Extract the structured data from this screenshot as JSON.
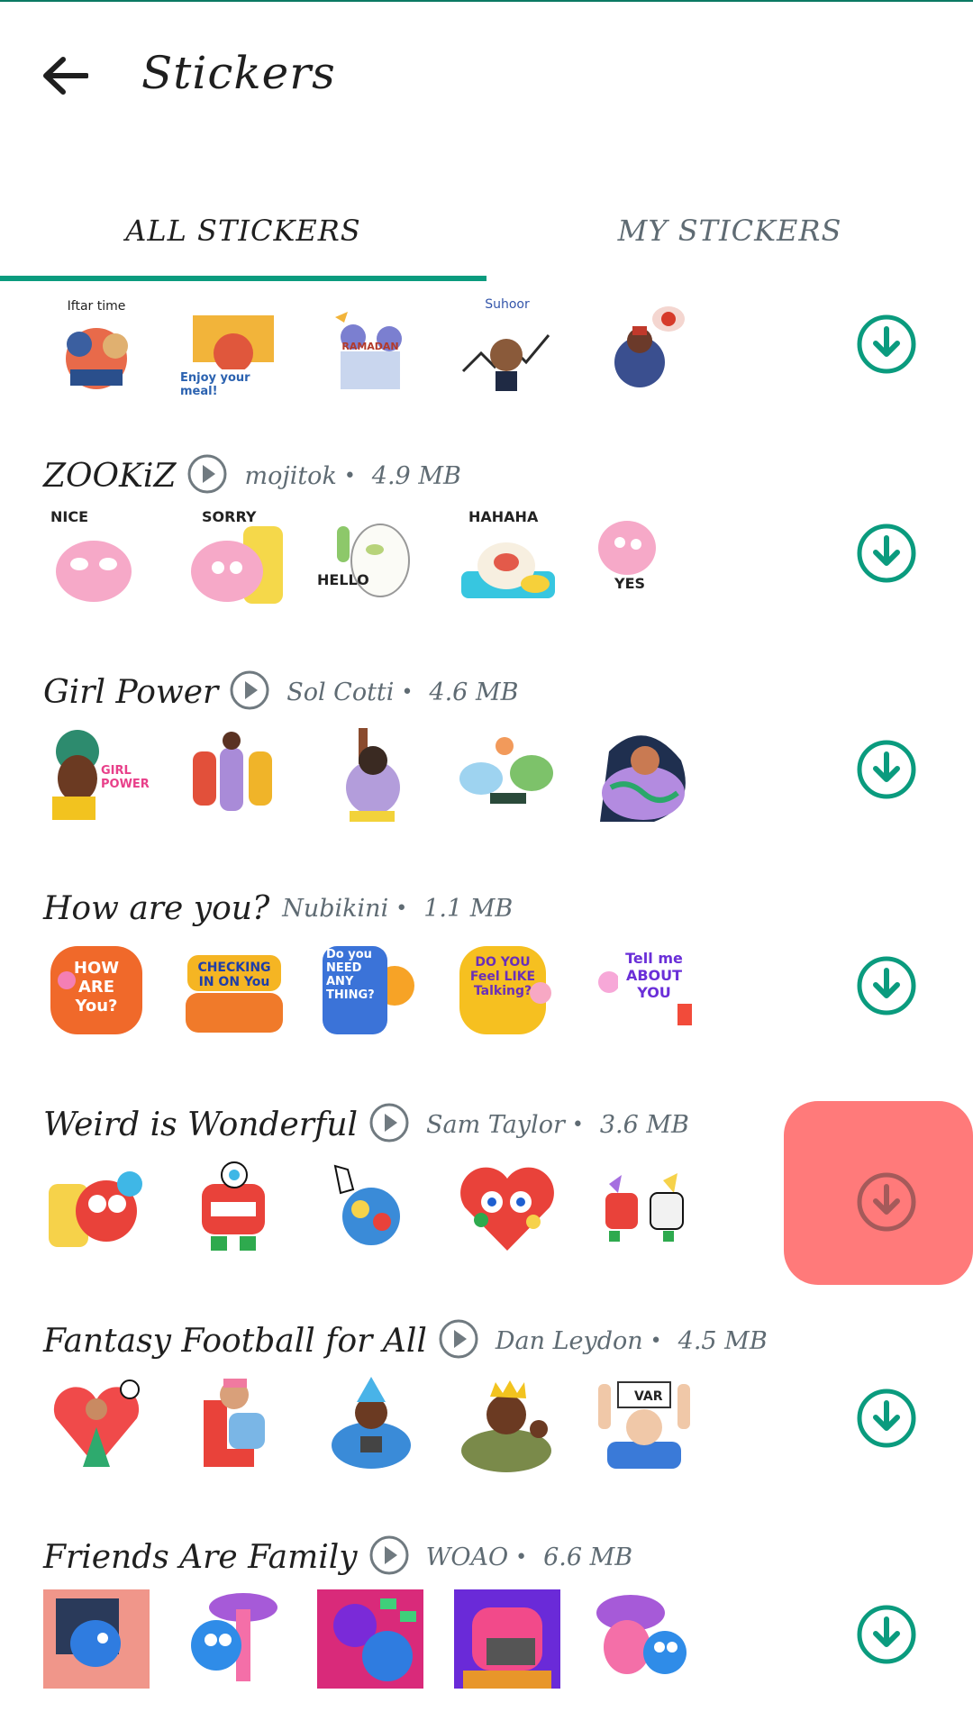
{
  "header": {
    "title": "Stickers"
  },
  "tabs": [
    {
      "label": "ALL STICKERS",
      "active": true
    },
    {
      "label": "MY STICKERS",
      "active": false
    }
  ],
  "colors": {
    "accent": "#0a9b7e",
    "highlight": "#ff7a7a"
  },
  "partial_pack": {
    "sticker_texts": [
      "Iftar time",
      "Enjoy your meal!",
      "RAMADAN",
      "Suhoor",
      ""
    ]
  },
  "packs": [
    {
      "name": "ZOOKiZ",
      "author": "mojitok",
      "size": "4.9 MB",
      "sticker_texts": [
        "NICE",
        "SORRY",
        "HELLO",
        "HAHAHA",
        "YES"
      ]
    },
    {
      "name": "Girl Power",
      "author": "Sol Cotti",
      "size": "4.6 MB",
      "sticker_texts": [
        "GIRL POWER",
        "",
        "",
        "",
        ""
      ]
    },
    {
      "name": "How are you?",
      "author": "Nubikini",
      "size": "1.1 MB",
      "sticker_texts": [
        "HOW ARE You?",
        "CHECKING IN ON You",
        "Do you NEED ANY THING?",
        "DO YOU Feel LIKE Talking?",
        "Tell me ABOUT YOU"
      ]
    },
    {
      "name": "Weird is Wonderful",
      "author": "Sam Taylor",
      "size": "3.6 MB",
      "sticker_texts": [
        "",
        "",
        "",
        "",
        ""
      ]
    },
    {
      "name": "Fantasy Football for All",
      "author": "Dan Leydon",
      "size": "4.5 MB",
      "sticker_texts": [
        "",
        "",
        "",
        "",
        "VAR"
      ]
    },
    {
      "name": "Friends Are Family",
      "author": "WOAO",
      "size": "6.6 MB",
      "sticker_texts": [
        "",
        "",
        "",
        "",
        ""
      ]
    }
  ],
  "separator": "•"
}
